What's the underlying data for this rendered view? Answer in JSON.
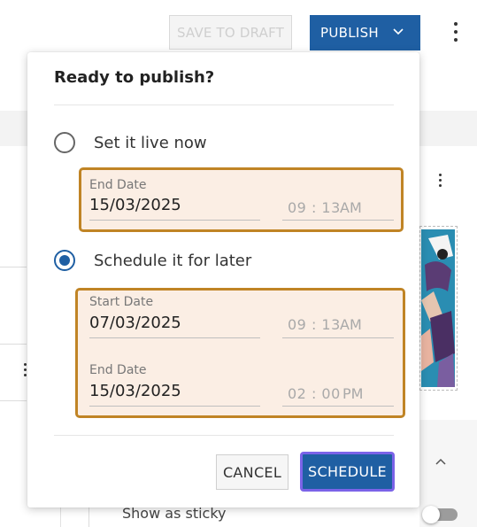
{
  "toolbar": {
    "save_draft_label": "SAVE TO DRAFT",
    "publish_label": "PUBLISH"
  },
  "background": {
    "sticky_label": "Show as sticky"
  },
  "popover": {
    "title": "Ready to publish?",
    "option_now": {
      "label": "Set it live now",
      "selected": false,
      "end": {
        "label": "End Date",
        "date": "15/03/2025",
        "hour": "09",
        "minute": "13",
        "ampm": "AM"
      }
    },
    "option_later": {
      "label": "Schedule it for later",
      "selected": true,
      "start": {
        "label": "Start Date",
        "date": "07/03/2025",
        "hour": "09",
        "minute": "13",
        "ampm": "AM"
      },
      "end": {
        "label": "End Date",
        "date": "15/03/2025",
        "hour": "02",
        "minute": "00",
        "ampm": "PM"
      }
    },
    "cancel_label": "CANCEL",
    "schedule_label": "SCHEDULE"
  },
  "colors": {
    "primary": "#1f5fa3",
    "highlight_border": "#c08425",
    "highlight_fill": "#fbeee4",
    "focus_ring": "#7b63e8"
  },
  "icons": [
    "chevron-down-icon",
    "kebab-menu-icon",
    "chevron-up-icon"
  ]
}
